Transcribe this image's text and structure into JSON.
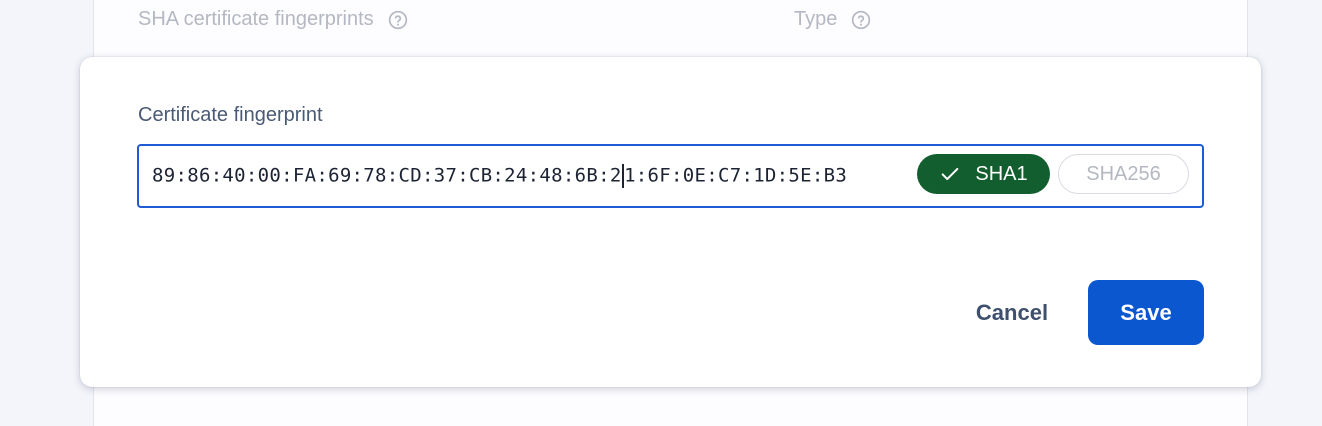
{
  "background_table": {
    "columns": [
      {
        "label": "SHA certificate fingerprints",
        "icon": "help-circle-icon"
      },
      {
        "label": "Type",
        "icon": "help-circle-icon"
      }
    ]
  },
  "dialog": {
    "field_label": "Certificate fingerprint",
    "input": {
      "value_before_caret": "89:86:40:00:FA:69:78:CD:37:CB:24:48:6B:2",
      "value_after_caret": "1:6F:0E:C7:1D:5E:B3"
    },
    "type_toggle": {
      "options": [
        {
          "label": "SHA1",
          "selected": true,
          "icon": "check-icon"
        },
        {
          "label": "SHA256",
          "selected": false
        }
      ]
    },
    "actions": {
      "cancel_label": "Cancel",
      "save_label": "Save"
    }
  },
  "colors": {
    "primary": "#0b57d0",
    "input_border": "#1f5bd4",
    "selected_chip": "#135e2f",
    "muted_text": "#b4b8c2"
  }
}
